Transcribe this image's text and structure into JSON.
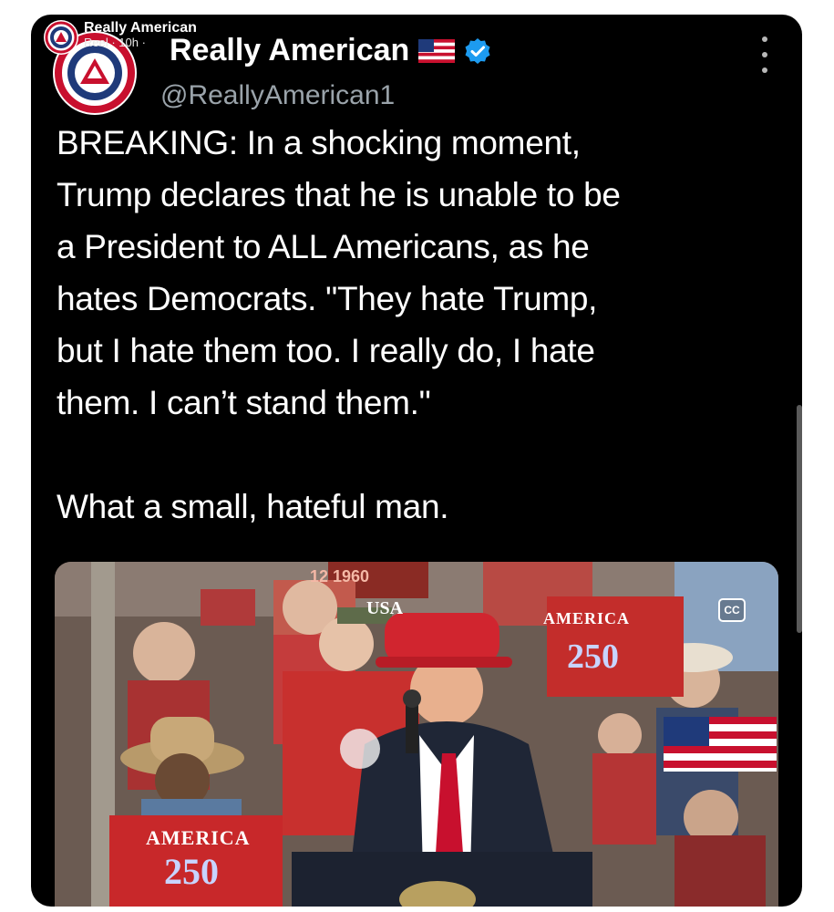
{
  "overlay": {
    "name": "Really American",
    "meta": "Reel · 10h ·"
  },
  "tweet": {
    "display_name": "Really American",
    "handle": "@ReallyAmerican1",
    "paragraph1": "BREAKING: In a shocking moment,\nTrump declares that he is unable to be\na President to ALL Americans, as he\nhates Democrats. \"They hate Trump,\nbut I hate them too. I really do, I hate\nthem. I can’t stand them.\"",
    "paragraph2": "What a small, hateful man."
  },
  "video": {
    "cc_label": "CC",
    "hat_text": "USA",
    "sign_left_word": "AMERICA",
    "sign_left_number": "250",
    "sign_right_word": "AMERICA",
    "sign_right_number": "250",
    "background_text": "12 1960"
  },
  "colors": {
    "card_background": "#000000",
    "text": "#ffffff",
    "handle": "#9aa3aa",
    "verified": "#1d9bf0",
    "logo_red": "#c8102e",
    "logo_blue": "#1f3a7a"
  }
}
